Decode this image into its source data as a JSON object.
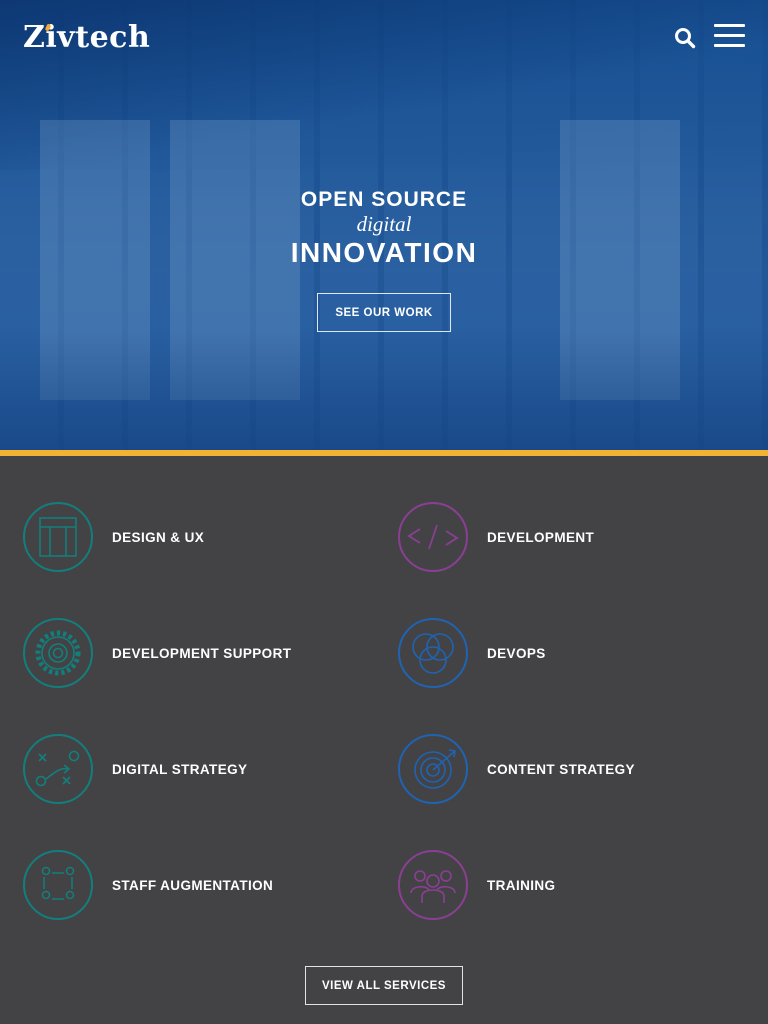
{
  "header": {
    "logo_text": "Zivtech",
    "search_icon": "search-icon",
    "menu_icon": "hamburger-menu-icon"
  },
  "hero": {
    "line1": "OPEN SOURCE",
    "line2": "digital",
    "line3": "INNOVATION",
    "cta_label": "SEE OUR WORK"
  },
  "colors": {
    "accent_bar": "#f4b233",
    "teal": "#127f7c",
    "purple": "#8a3f92",
    "blue": "#1f63b2",
    "services_bg": "#434346"
  },
  "services": {
    "items": [
      {
        "label": "DESIGN & UX",
        "icon": "layout-icon",
        "color": "#127f7c"
      },
      {
        "label": "DEVELOPMENT",
        "icon": "code-icon",
        "color": "#8a3f92"
      },
      {
        "label": "DEVELOPMENT SUPPORT",
        "icon": "gear-icon",
        "color": "#127f7c"
      },
      {
        "label": "DEVOPS",
        "icon": "venn-diagram-icon",
        "color": "#1f63b2"
      },
      {
        "label": "DIGITAL STRATEGY",
        "icon": "strategy-play-icon",
        "color": "#127f7c"
      },
      {
        "label": "CONTENT STRATEGY",
        "icon": "target-icon",
        "color": "#1f63b2"
      },
      {
        "label": "STAFF AUGMENTATION",
        "icon": "team-arrows-icon",
        "color": "#127f7c"
      },
      {
        "label": "TRAINING",
        "icon": "people-group-icon",
        "color": "#8a3f92"
      }
    ],
    "view_all_label": "VIEW ALL SERVICES"
  }
}
